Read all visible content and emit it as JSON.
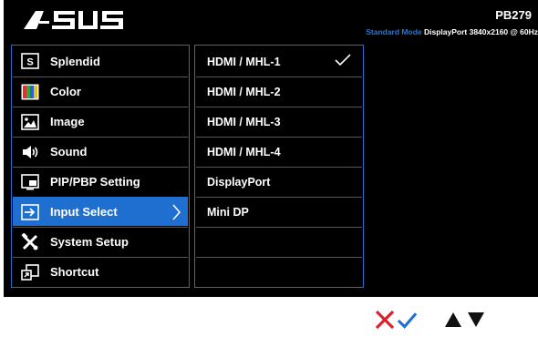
{
  "header": {
    "brand": "ASUS",
    "model": "PB279",
    "mode": "Standard Mode",
    "info": "DisplayPort  3840x2160 @ 60Hz"
  },
  "menu": {
    "items": [
      {
        "label": "Splendid",
        "icon": "splendid-s-icon"
      },
      {
        "label": "Color",
        "icon": "color-bars-icon"
      },
      {
        "label": "Image",
        "icon": "image-icon"
      },
      {
        "label": "Sound",
        "icon": "speaker-icon"
      },
      {
        "label": "PIP/PBP Setting",
        "icon": "pip-icon"
      },
      {
        "label": "Input Select",
        "icon": "input-arrow-icon",
        "selected": true
      },
      {
        "label": "System Setup",
        "icon": "tools-icon"
      },
      {
        "label": "Shortcut",
        "icon": "shortcut-icon"
      }
    ]
  },
  "submenu": {
    "items": [
      {
        "label": "HDMI / MHL-1",
        "checked": true
      },
      {
        "label": "HDMI / MHL-2"
      },
      {
        "label": "HDMI / MHL-3"
      },
      {
        "label": "HDMI / MHL-4"
      },
      {
        "label": "DisplayPort"
      },
      {
        "label": "Mini DP"
      },
      {
        "label": ""
      },
      {
        "label": ""
      }
    ]
  },
  "controls": {
    "buttons": [
      "close-icon",
      "confirm-check-icon",
      "up-arrow-icon",
      "down-arrow-icon"
    ]
  },
  "colors": {
    "accent": "#1e6fd0",
    "mode_text": "#2e74c8",
    "close": "#d9232a",
    "check": "#1e6fd0"
  }
}
